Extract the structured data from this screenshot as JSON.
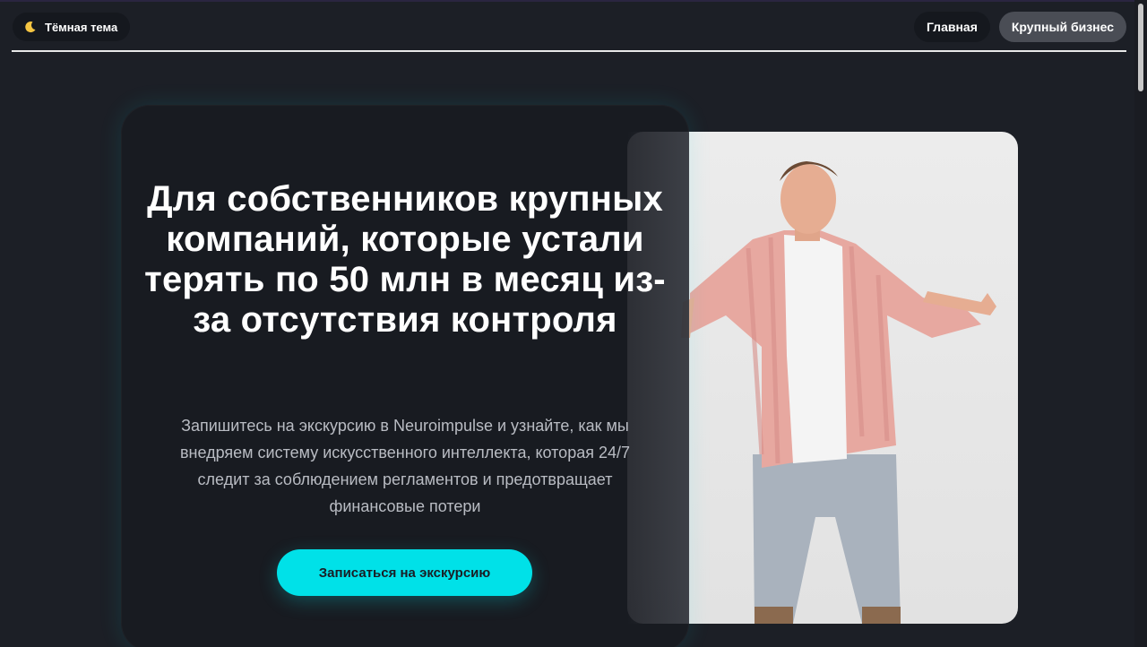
{
  "header": {
    "theme_toggle": {
      "label": "Тёмная тема",
      "icon": "moon-icon"
    },
    "nav": [
      {
        "label": "Главная",
        "active": false
      },
      {
        "label": "Крупный бизнес",
        "active": true
      }
    ]
  },
  "hero": {
    "headline": "Для собственников крупных компаний, которые устали терять по 50 млн в месяц из-за отсутствия контроля",
    "subtext": "Запишитесь на экскурсию в Neuroimpulse и узнайте, как мы внедряем систему искусственного интеллекта, которая 24/7 следит за соблюдением регламентов и предотвращает финансовые потери",
    "cta_label": "Записаться на экскурсию"
  },
  "colors": {
    "background": "#1c1f26",
    "accent": "#00e1e8",
    "active_nav": "#4a4d55"
  }
}
